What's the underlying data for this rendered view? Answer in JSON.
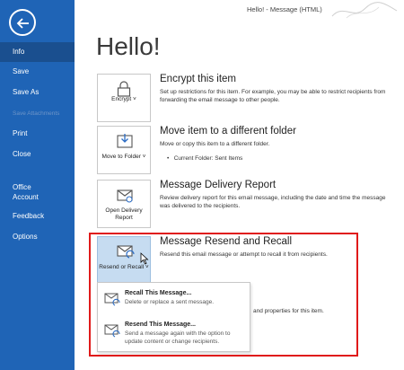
{
  "window": {
    "title": "Hello!  -  Message (HTML)"
  },
  "sidebar": {
    "items": [
      {
        "label": "Info",
        "selected": true,
        "enabled": true
      },
      {
        "label": "Save",
        "enabled": true
      },
      {
        "label": "Save As",
        "enabled": true
      },
      {
        "label": "Save Attachments",
        "enabled": false
      },
      {
        "label": "Print",
        "enabled": true
      },
      {
        "label": "Close",
        "enabled": true
      },
      {
        "label": "Office\nAccount",
        "enabled": true
      },
      {
        "label": "Feedback",
        "enabled": true
      },
      {
        "label": "Options",
        "enabled": true
      }
    ]
  },
  "main": {
    "title": "Hello!",
    "sections": [
      {
        "tile_label": "Encrypt ˅",
        "title": "Encrypt this item",
        "description": "Set up restrictions for this item. For example, you may be able to restrict recipients from forwarding the email message to other people."
      },
      {
        "tile_label": "Move to Folder ˅",
        "title": "Move item to a different folder",
        "description": "Move or copy this item to a different folder.",
        "current_folder_label": "Current Folder:",
        "current_folder_value": "Sent Items"
      },
      {
        "tile_label": "Open Delivery Report",
        "title": "Message Delivery Report",
        "description": "Review delivery report for this email message, including the date and time the message was delivered to the recipients."
      },
      {
        "tile_label": "Resend or Recall ˅",
        "title": "Message Resend and Recall",
        "description": "Resend this email message or attempt to recall it from recipients."
      }
    ],
    "partial_text": "and properties for this item."
  },
  "dropdown": {
    "items": [
      {
        "title": "Recall This Message...",
        "description": "Delete or replace a sent message."
      },
      {
        "title": "Resend This Message...",
        "description": "Send a message again with the option to update content or change recipients."
      }
    ]
  },
  "colors": {
    "sidebar": "#1f64b6",
    "selected": "#1a4f8f",
    "highlight": "#e01a1a",
    "tile_hover": "#c6dcf1"
  }
}
